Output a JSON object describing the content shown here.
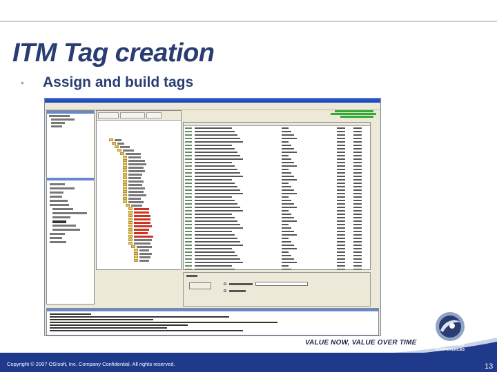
{
  "slide": {
    "title": "ITM Tag creation",
    "bullet": "Assign and build tags",
    "tagline": "VALUE NOW, VALUE OVER TIME",
    "copyright": "Copyright © 2007 OSIsoft, Inc. Company Confidential. All rights reserved.",
    "page_number": "13",
    "logo_text": [
      "OSISOFT USER",
      "CONFERENCES"
    ]
  },
  "colors": {
    "title": "#2a3d73",
    "footer": "#1f3a8a",
    "app_titlebar": "#2a5bd7"
  }
}
